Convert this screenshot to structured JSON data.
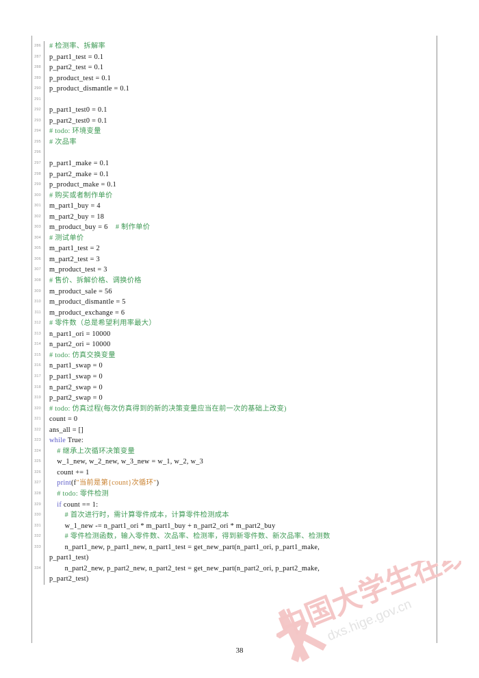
{
  "document": {
    "page_number": "38",
    "watermark": {
      "text_cn": "中国大学生在线",
      "text_url": "dxs.hige.gov.cn",
      "color": "#f3c3c3"
    },
    "colors": {
      "comment": "#3f9a55",
      "keyword": "#5b5bc8",
      "string": "#c9812f",
      "plain": "#101010",
      "lineno": "#9b9b9b",
      "gutter": "#8f8f8f",
      "rule": "#9a9a9a"
    }
  },
  "listing": {
    "language": "python",
    "first_line": 286,
    "last_line": 334,
    "lines": [
      {
        "no": "286",
        "segments": [
          {
            "t": "# 检测率、拆解率",
            "c": "cm"
          }
        ]
      },
      {
        "no": "287",
        "segments": [
          {
            "t": "p_part1_test = 0.1",
            "c": "nm"
          }
        ]
      },
      {
        "no": "288",
        "segments": [
          {
            "t": "p_part2_test = 0.1",
            "c": "nm"
          }
        ]
      },
      {
        "no": "289",
        "segments": [
          {
            "t": "p_product_test = 0.1",
            "c": "nm"
          }
        ]
      },
      {
        "no": "290",
        "segments": [
          {
            "t": "p_product_dismantle = 0.1",
            "c": "nm"
          }
        ]
      },
      {
        "no": "291",
        "segments": [
          {
            "t": "",
            "c": "nm"
          }
        ]
      },
      {
        "no": "292",
        "segments": [
          {
            "t": "p_part1_test0 = 0.1",
            "c": "nm"
          }
        ]
      },
      {
        "no": "293",
        "segments": [
          {
            "t": "p_part2_test0 = 0.1",
            "c": "nm"
          }
        ]
      },
      {
        "no": "294",
        "segments": [
          {
            "t": "# todo: 环境变量",
            "c": "cm"
          }
        ]
      },
      {
        "no": "295",
        "segments": [
          {
            "t": "# 次品率",
            "c": "cm"
          }
        ]
      },
      {
        "no": "296",
        "segments": [
          {
            "t": "",
            "c": "nm"
          }
        ]
      },
      {
        "no": "297",
        "segments": [
          {
            "t": "p_part1_make = 0.1",
            "c": "nm"
          }
        ]
      },
      {
        "no": "298",
        "segments": [
          {
            "t": "p_part2_make = 0.1",
            "c": "nm"
          }
        ]
      },
      {
        "no": "299",
        "segments": [
          {
            "t": "p_product_make = 0.1",
            "c": "nm"
          }
        ]
      },
      {
        "no": "300",
        "segments": [
          {
            "t": "# 购买或者制作单价",
            "c": "cm"
          }
        ]
      },
      {
        "no": "301",
        "segments": [
          {
            "t": "m_part1_buy = 4",
            "c": "nm"
          }
        ]
      },
      {
        "no": "302",
        "segments": [
          {
            "t": "m_part2_buy = 18",
            "c": "nm"
          }
        ]
      },
      {
        "no": "303",
        "segments": [
          {
            "t": "m_product_buy = 6",
            "c": "nm"
          },
          {
            "t": "    # 制作单价",
            "c": "cm"
          }
        ]
      },
      {
        "no": "304",
        "segments": [
          {
            "t": "# 测试单价",
            "c": "cm"
          }
        ]
      },
      {
        "no": "305",
        "segments": [
          {
            "t": "m_part1_test = 2",
            "c": "nm"
          }
        ]
      },
      {
        "no": "306",
        "segments": [
          {
            "t": "m_part2_test = 3",
            "c": "nm"
          }
        ]
      },
      {
        "no": "307",
        "segments": [
          {
            "t": "m_product_test = 3",
            "c": "nm"
          }
        ]
      },
      {
        "no": "308",
        "segments": [
          {
            "t": "# 售价、拆解价格、调换价格",
            "c": "cm"
          }
        ]
      },
      {
        "no": "309",
        "segments": [
          {
            "t": "m_product_sale = 56",
            "c": "nm"
          }
        ]
      },
      {
        "no": "310",
        "segments": [
          {
            "t": "m_product_dismantle = 5",
            "c": "nm"
          }
        ]
      },
      {
        "no": "311",
        "segments": [
          {
            "t": "m_product_exchange = 6",
            "c": "nm"
          }
        ]
      },
      {
        "no": "312",
        "segments": [
          {
            "t": "# 零件数（总是希望利用率最大）",
            "c": "cm"
          }
        ]
      },
      {
        "no": "313",
        "segments": [
          {
            "t": "n_part1_ori = 10000",
            "c": "nm"
          }
        ]
      },
      {
        "no": "314",
        "segments": [
          {
            "t": "n_part2_ori = 10000",
            "c": "nm"
          }
        ]
      },
      {
        "no": "315",
        "segments": [
          {
            "t": "# todo: 仿真交换变量",
            "c": "cm"
          }
        ]
      },
      {
        "no": "316",
        "segments": [
          {
            "t": "n_part1_swap = 0",
            "c": "nm"
          }
        ]
      },
      {
        "no": "317",
        "segments": [
          {
            "t": "p_part1_swap = 0",
            "c": "nm"
          }
        ]
      },
      {
        "no": "318",
        "segments": [
          {
            "t": "n_part2_swap = 0",
            "c": "nm"
          }
        ]
      },
      {
        "no": "319",
        "segments": [
          {
            "t": "p_part2_swap = 0",
            "c": "nm"
          }
        ]
      },
      {
        "no": "320",
        "segments": [
          {
            "t": "# todo: 仿真过程(每次仿真得到的新的决策变量应当在前一次的基础上改变)",
            "c": "cm"
          }
        ]
      },
      {
        "no": "321",
        "segments": [
          {
            "t": "count = 0",
            "c": "nm"
          }
        ]
      },
      {
        "no": "322",
        "segments": [
          {
            "t": "ans_all = []",
            "c": "nm"
          }
        ]
      },
      {
        "no": "323",
        "segments": [
          {
            "t": "while",
            "c": "kw"
          },
          {
            "t": " True:",
            "c": "nm"
          }
        ]
      },
      {
        "no": "324",
        "segments": [
          {
            "t": "    # 继承上次循环决策变量",
            "c": "cm"
          }
        ]
      },
      {
        "no": "325",
        "segments": [
          {
            "t": "    w_1_new, w_2_new, w_3_new = w_1, w_2, w_3",
            "c": "nm"
          }
        ]
      },
      {
        "no": "326",
        "segments": [
          {
            "t": "    count += 1",
            "c": "nm"
          }
        ]
      },
      {
        "no": "327",
        "segments": [
          {
            "t": "    ",
            "c": "nm"
          },
          {
            "t": "print",
            "c": "bi"
          },
          {
            "t": "(f",
            "c": "nm"
          },
          {
            "t": "\"当前是第{count}次循环\"",
            "c": "st"
          },
          {
            "t": ")",
            "c": "nm"
          }
        ]
      },
      {
        "no": "328",
        "segments": [
          {
            "t": "    # todo: 零件检测",
            "c": "cm"
          }
        ]
      },
      {
        "no": "329",
        "segments": [
          {
            "t": "    ",
            "c": "nm"
          },
          {
            "t": "if",
            "c": "kw"
          },
          {
            "t": " count == 1:",
            "c": "nm"
          }
        ]
      },
      {
        "no": "330",
        "segments": [
          {
            "t": "        # 首次进行时，需计算零件成本，计算零件检测成本",
            "c": "cm"
          }
        ]
      },
      {
        "no": "331",
        "segments": [
          {
            "t": "        w_1_new -= n_part1_ori * m_part1_buy + n_part2_ori * m_part2_buy",
            "c": "nm"
          }
        ]
      },
      {
        "no": "332",
        "segments": [
          {
            "t": "        # 零件检测函数，输入零件数、次品率、检测率，得到新零件数、新次品率、检测数",
            "c": "cm"
          }
        ]
      },
      {
        "no": "333",
        "segments": [
          {
            "t": "        n_part1_new, p_part1_new, n_part1_test = get_new_part(n_part1_ori, p_part1_make,\np_part1_test)",
            "c": "nm"
          }
        ]
      },
      {
        "no": "334",
        "segments": [
          {
            "t": "        n_part2_new, p_part2_new, n_part2_test = get_new_part(n_part2_ori, p_part2_make,\np_part2_test)",
            "c": "nm"
          }
        ]
      }
    ]
  }
}
